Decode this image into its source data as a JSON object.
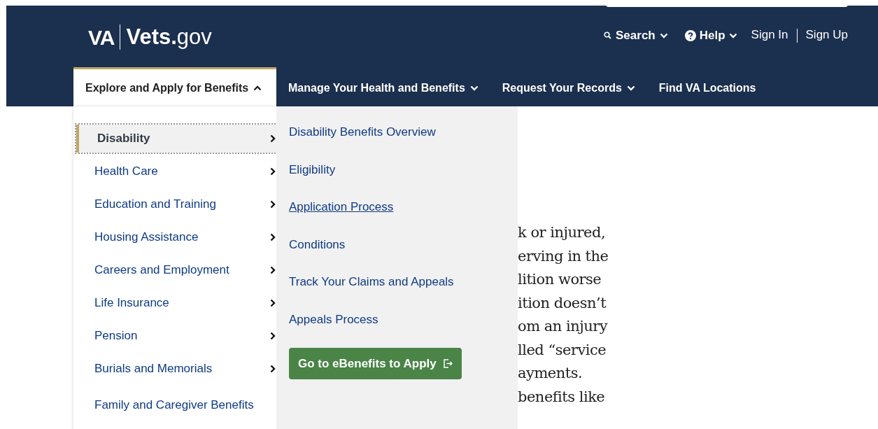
{
  "header": {
    "logo_agency": "VA",
    "logo_site": "**Vets.**gov",
    "utility": [
      {
        "kind": "search",
        "label": "Search"
      },
      {
        "kind": "help",
        "label": "Help"
      },
      {
        "kind": "link",
        "label": "Sign In"
      },
      {
        "kind": "link",
        "label": "Sign Up"
      }
    ]
  },
  "nav": [
    {
      "label": "Explore and Apply for Benefits",
      "kind": "dropdown",
      "selected": true
    },
    {
      "label": "Manage Your Health and Benefits",
      "kind": "dropdown",
      "selected": false
    },
    {
      "label": "Request Your Records",
      "kind": "dropdown",
      "selected": false
    },
    {
      "label": "Find VA Locations",
      "kind": "link",
      "selected": false
    }
  ],
  "menu": {
    "items": [
      {
        "label": "Disability",
        "selected": true,
        "has_submenu": true
      },
      {
        "label": "Health Care",
        "selected": false,
        "has_submenu": true
      },
      {
        "label": "Education and Training",
        "selected": false,
        "has_submenu": true
      },
      {
        "label": "Housing Assistance",
        "selected": false,
        "has_submenu": true
      },
      {
        "label": "Careers and Employment",
        "selected": false,
        "has_submenu": true
      },
      {
        "label": "Life Insurance",
        "selected": false,
        "has_submenu": true
      },
      {
        "label": "Pension",
        "selected": false,
        "has_submenu": true
      },
      {
        "label": "Burials and Memorials",
        "selected": false,
        "has_submenu": true
      },
      {
        "label": "Family and Caregiver Benefits",
        "selected": false,
        "has_submenu": false
      }
    ],
    "submenu": [
      {
        "label": "Disability Benefits Overview",
        "hovered": false
      },
      {
        "label": "Eligibility",
        "hovered": false
      },
      {
        "label": "Application Process",
        "hovered": true
      },
      {
        "label": "Conditions",
        "hovered": false
      },
      {
        "label": "Track Your Claims and Appeals",
        "hovered": false
      },
      {
        "label": "Appeals Process",
        "hovered": false
      }
    ],
    "button": "Go to eBenefits to Apply"
  },
  "article": {
    "lines": [
      "k or injured,",
      "erving in the",
      "lition worse",
      "ition doesn’t",
      "om an injury",
      "lled “service",
      "ayments.",
      "benefits like"
    ]
  }
}
